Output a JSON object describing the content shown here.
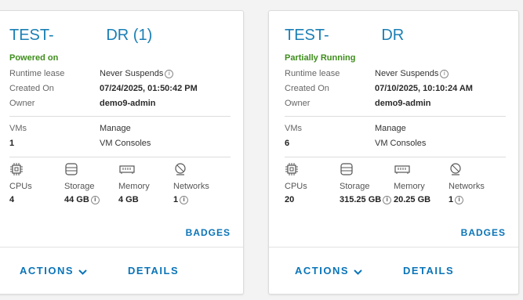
{
  "cards": [
    {
      "title_left": "TEST-",
      "title_right": "DR (1)",
      "status": "Powered on",
      "status_color": "#3e8d1c",
      "runtime_lease_label": "Runtime lease",
      "runtime_lease_value": "Never Suspends",
      "created_on_label": "Created On",
      "created_on_value": "07/24/2025, 01:50:42 PM",
      "owner_label": "Owner",
      "owner_value": "demo9-admin",
      "vms_label": "VMs",
      "vms_value": "1",
      "manage_link": "Manage",
      "vm_consoles_link": "VM Consoles",
      "resources": [
        {
          "icon": "cpu-icon",
          "label": "CPUs",
          "value": "4",
          "info": false
        },
        {
          "icon": "storage-icon",
          "label": "Storage",
          "value": "44 GB",
          "info": true
        },
        {
          "icon": "memory-icon",
          "label": "Memory",
          "value": "4 GB",
          "info": false
        },
        {
          "icon": "network-icon",
          "label": "Networks",
          "value": "1",
          "info": true
        }
      ],
      "badges_label": "BADGES",
      "actions_label": "ACTIONS",
      "details_label": "DETAILS"
    },
    {
      "title_left": "TEST-",
      "title_right": "DR",
      "status": "Partially Running",
      "status_color": "#3e8d1c",
      "runtime_lease_label": "Runtime lease",
      "runtime_lease_value": "Never Suspends",
      "created_on_label": "Created On",
      "created_on_value": "07/10/2025, 10:10:24 AM",
      "owner_label": "Owner",
      "owner_value": "demo9-admin",
      "vms_label": "VMs",
      "vms_value": "6",
      "manage_link": "Manage",
      "vm_consoles_link": "VM Consoles",
      "resources": [
        {
          "icon": "cpu-icon",
          "label": "CPUs",
          "value": "20",
          "info": false
        },
        {
          "icon": "storage-icon",
          "label": "Storage",
          "value": "315.25 GB",
          "info": true
        },
        {
          "icon": "memory-icon",
          "label": "Memory",
          "value": "20.25 GB",
          "info": false
        },
        {
          "icon": "network-icon",
          "label": "Networks",
          "value": "1",
          "info": true
        }
      ],
      "badges_label": "BADGES",
      "actions_label": "ACTIONS",
      "details_label": "DETAILS"
    }
  ],
  "info_glyph": "i",
  "accent_color": "#0a74b8",
  "title_color": "#1a7fb5"
}
